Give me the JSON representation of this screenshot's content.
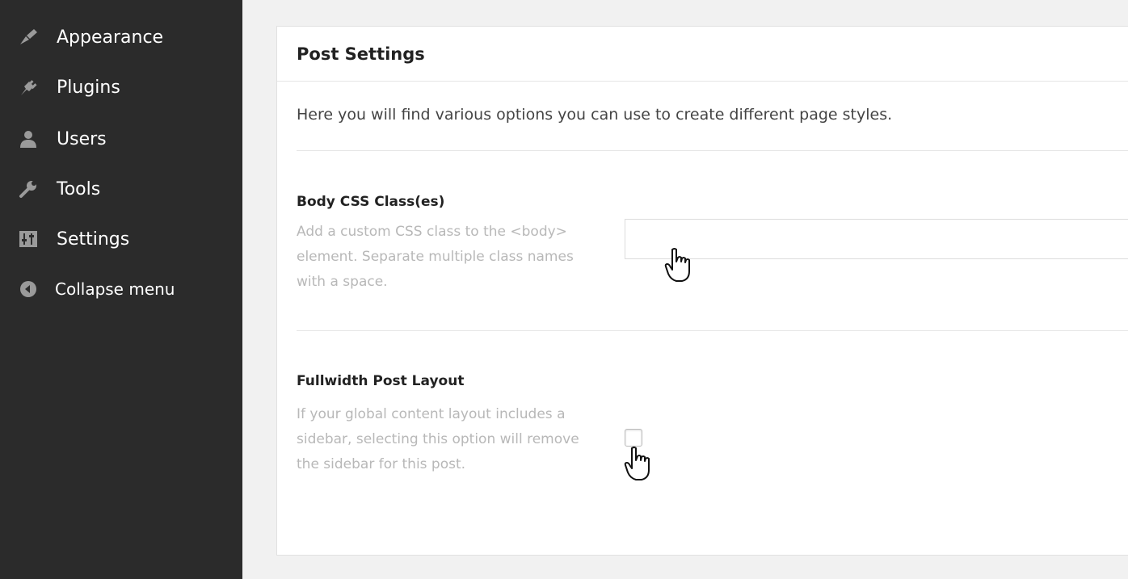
{
  "sidebar": {
    "items": [
      {
        "label": "Appearance",
        "icon": "paintbrush-icon"
      },
      {
        "label": "Plugins",
        "icon": "plug-icon"
      },
      {
        "label": "Users",
        "icon": "users-icon"
      },
      {
        "label": "Tools",
        "icon": "wrench-icon"
      },
      {
        "label": "Settings",
        "icon": "settings-icon"
      }
    ],
    "collapse_label": "Collapse menu"
  },
  "panel": {
    "title": "Post Settings",
    "intro": "Here you will find various options you can use to create different page styles.",
    "body_css": {
      "title": "Body CSS Class(es)",
      "description": "Add a custom CSS class to the <body> element. Separate multiple class names with a space.",
      "value": "",
      "placeholder": ""
    },
    "fullwidth": {
      "title": "Fullwidth Post Layout",
      "description": "If your global content layout includes a sidebar, selecting this option will remove the sidebar for this post.",
      "checked": false
    }
  },
  "colors": {
    "sidebar_bg": "#2b2b2b",
    "page_bg": "#f1f1f1",
    "desc_text": "#b8b8b8"
  }
}
